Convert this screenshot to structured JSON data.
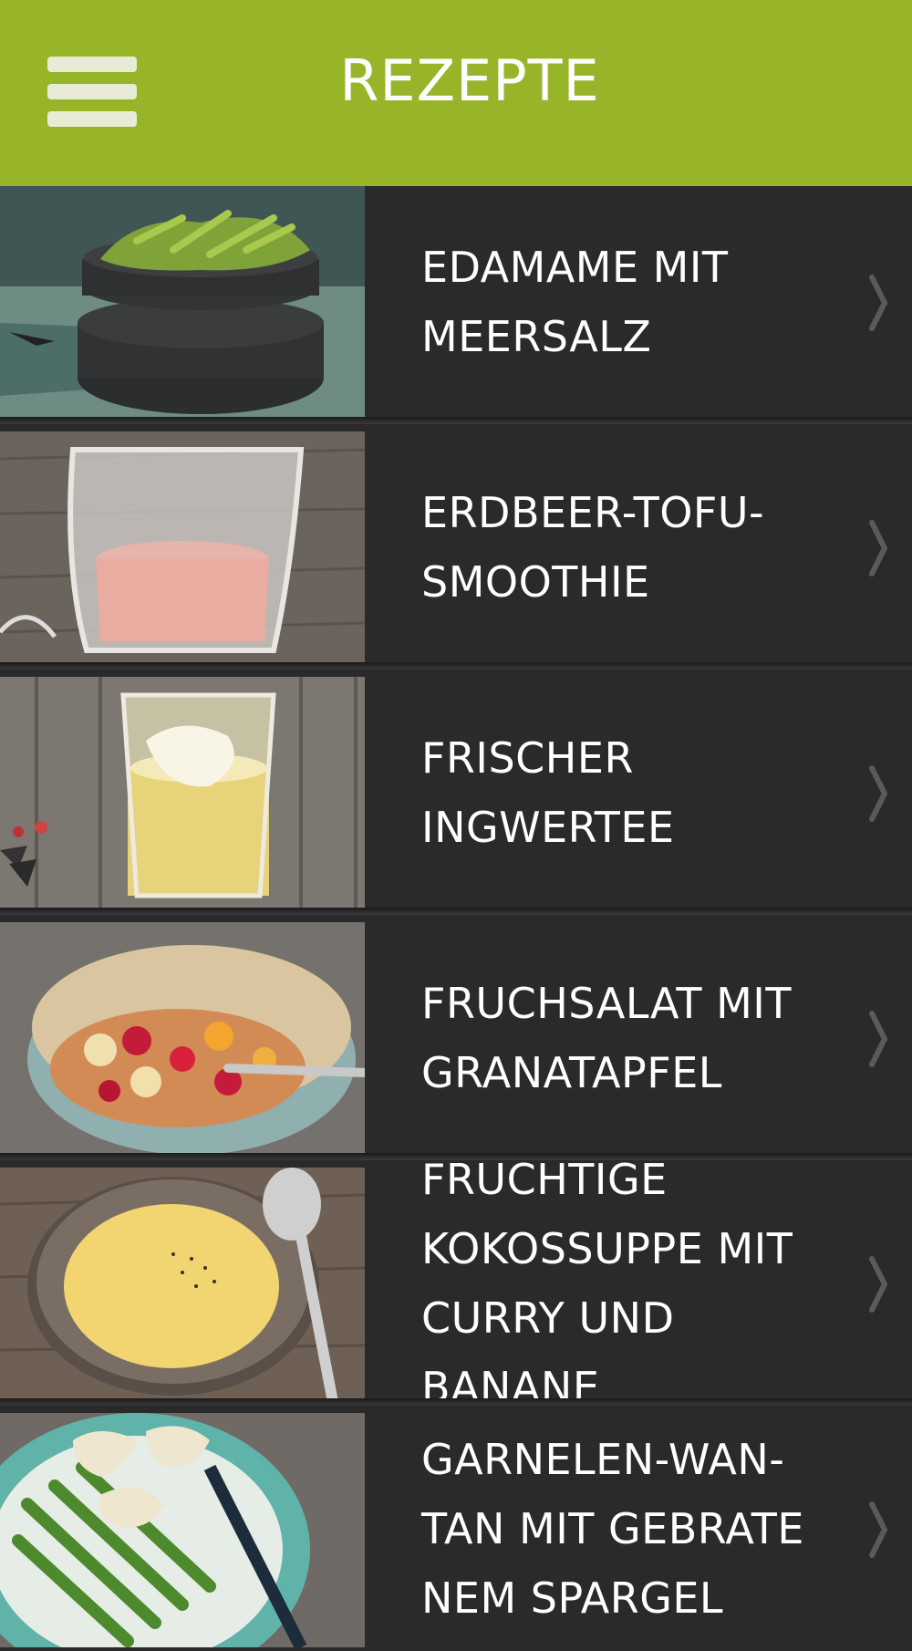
{
  "header": {
    "title": "REZEPTE",
    "menu_icon": "hamburger-menu-icon",
    "background": "#98b52a"
  },
  "recipes": [
    {
      "title": "EDAMAME MIT\nMEERSALZ",
      "image": "edamame-bowl-photo"
    },
    {
      "title": "ERDBEER-TOFU-\nSMOOTHIE",
      "image": "strawberry-smoothie-photo"
    },
    {
      "title": "FRISCHER INGWERTEE",
      "image": "ginger-tea-photo"
    },
    {
      "title": "FRUCHSALAT MIT\nGRANATAPFEL",
      "image": "fruit-salad-photo"
    },
    {
      "title": "FRUCHTIGE\nKOKOSSUPPE MIT\nCURRY UND BANANE",
      "image": "coconut-soup-photo"
    },
    {
      "title": "GARNELEN-WAN-\nTAN MIT GEBRATE\nNEM SPARGEL",
      "image": "shrimp-wonton-photo"
    }
  ],
  "chevron_icon": "chevron-right-icon"
}
